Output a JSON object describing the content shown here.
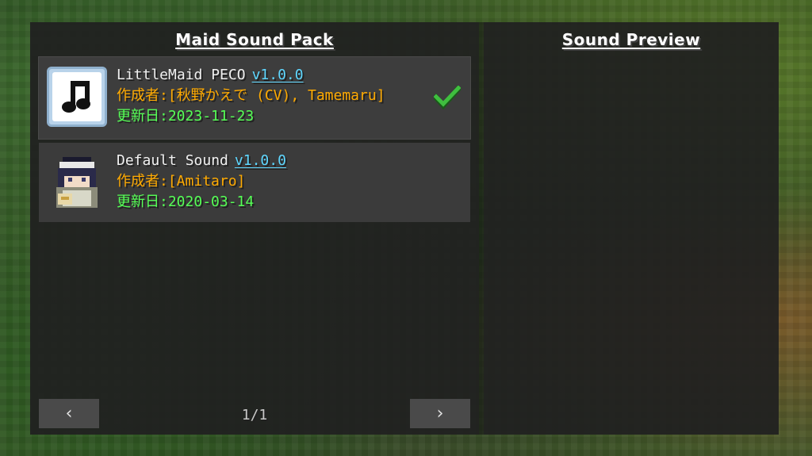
{
  "left_panel": {
    "title": "Maid Sound Pack",
    "packs": [
      {
        "name": "LittleMaid PECO",
        "version": "v1.0.0",
        "author_label": "作成者:",
        "author": "[秋野かえで (CV), Tamemaru]",
        "date_label": "更新日:",
        "date": "2023-11-23",
        "icon": "music-note-icon",
        "selected": true
      },
      {
        "name": "Default Sound",
        "version": "v1.0.0",
        "author_label": "作成者:",
        "author": "[Amitaro]",
        "date_label": "更新日:",
        "date": "2020-03-14",
        "icon": "maid-avatar-icon",
        "selected": false
      }
    ],
    "pagination": {
      "prev_label": "‹",
      "next_label": "›",
      "page_text": "1/1"
    }
  },
  "right_panel": {
    "title": "Sound Preview"
  },
  "colors": {
    "version": "#5fd7ff",
    "author": "#ffaa00",
    "date": "#55ff55",
    "check": "#3fbf3f"
  }
}
